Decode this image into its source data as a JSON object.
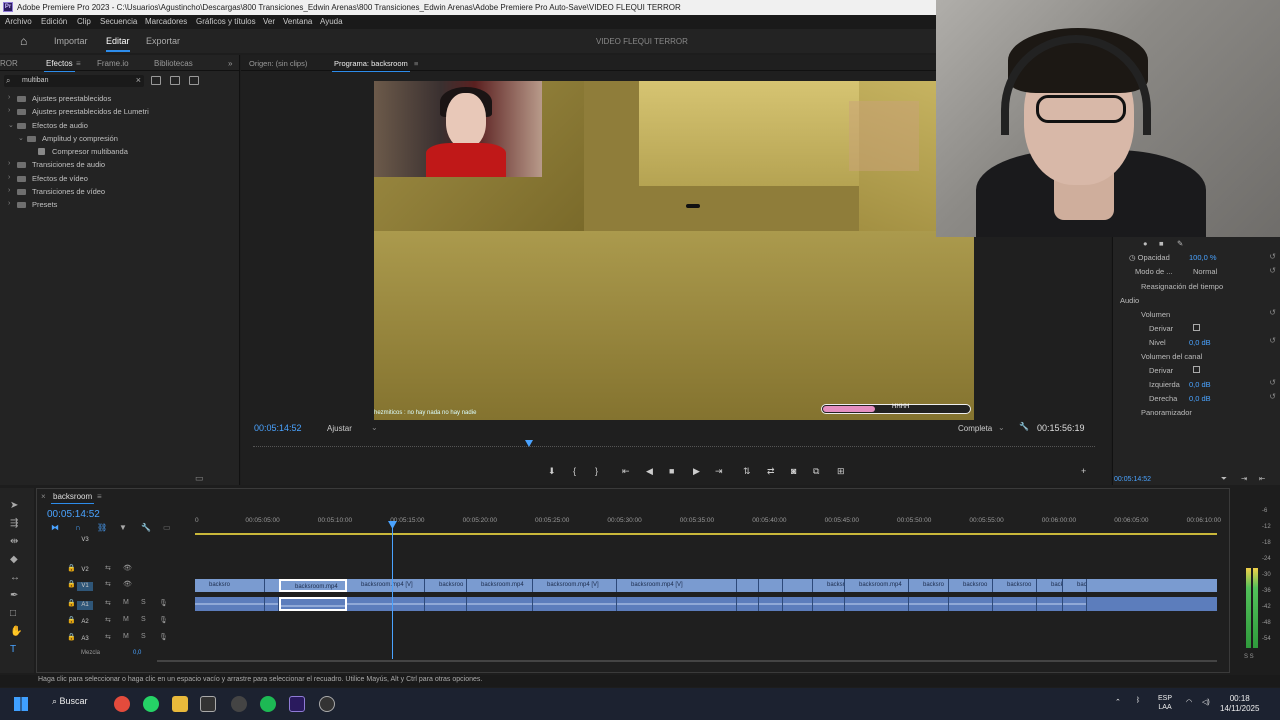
{
  "titlebar": {
    "text": "Adobe Premiere Pro 2023 - C:\\Usuarios\\Agustincho\\Descargas\\800 Transiciones_Edwin Arenas\\800 Transiciones_Edwin Arenas\\Adobe Premiere Pro Auto-Save\\VIDEO FLEQUI TERROR"
  },
  "menu": [
    "Archivo",
    "Edición",
    "Clip",
    "Secuencia",
    "Marcadores",
    "Gráficos y títulos",
    "Ver",
    "Ventana",
    "Ayuda"
  ],
  "workspace": {
    "tabs": [
      "Importar",
      "Editar",
      "Exportar"
    ],
    "active": "Editar",
    "project_title": "VIDEO FLEQUI TERROR"
  },
  "effects_panel": {
    "tab_cut": "ROR",
    "tabs": [
      "Efectos",
      "Frame.io",
      "Bibliotecas"
    ],
    "search_value": "multiban",
    "tree": [
      {
        "label": "Ajustes preestablecidos",
        "indent": 0,
        "kind": "folder",
        "open": false
      },
      {
        "label": "Ajustes preestablecidos de Lumetri",
        "indent": 0,
        "kind": "folder",
        "open": false
      },
      {
        "label": "Efectos de audio",
        "indent": 0,
        "kind": "folder",
        "open": true
      },
      {
        "label": "Amplitud y compresión",
        "indent": 1,
        "kind": "folder",
        "open": true
      },
      {
        "label": "Compresor multibanda",
        "indent": 2,
        "kind": "effect",
        "open": false
      },
      {
        "label": "Transiciones de audio",
        "indent": 0,
        "kind": "folder",
        "open": false
      },
      {
        "label": "Efectos de vídeo",
        "indent": 0,
        "kind": "folder",
        "open": false
      },
      {
        "label": "Transiciones de vídeo",
        "indent": 0,
        "kind": "folder",
        "open": false
      },
      {
        "label": "Presets",
        "indent": 0,
        "kind": "folder",
        "open": false
      }
    ]
  },
  "program_monitor": {
    "source_tab": "Origen: (sin clips)",
    "program_tab": "Programa: backsroom",
    "timecode": "00:05:14:52",
    "fit": "Ajustar",
    "quality": "Completa",
    "duration": "00:15:56:19",
    "chat_line": "hezmiticos : no hay nada no hay nadie",
    "hp_text": "HHHH",
    "hp_fill": 0.35
  },
  "effect_controls": {
    "opacity_label": "Opacidad",
    "opacity_value": "100,0 %",
    "blend_label": "Modo de ...",
    "blend_value": "Normal",
    "time_remap": "Reasignación del tiempo",
    "audio_label": "Audio",
    "volume": "Volumen",
    "bypass": "Derivar",
    "level": "Nivel",
    "level_value": "0,0 dB",
    "channel_volume": "Volumen del canal",
    "bypass2": "Derivar",
    "left": "Izquierda",
    "left_value": "0,0 dB",
    "right": "Derecha",
    "right_value": "0,0 dB",
    "panner": "Panoramizador",
    "footer_tc": "00:05:14:52"
  },
  "timeline": {
    "sequence": "backsroom",
    "timecode": "00:05:14:52",
    "ruler": [
      "0",
      "00:05:05:00",
      "00:05:10:00",
      "00:05:15:00",
      "00:05:20:00",
      "00:05:25:00",
      "00:05:30:00",
      "00:05:35:00",
      "00:05:40:00",
      "00:05:45:00",
      "00:05:50:00",
      "00:05:55:00",
      "00:06:00:00",
      "00:06:05:00",
      "00:06:10:00"
    ],
    "tracks": {
      "v3": "V3",
      "v2": "V2",
      "v1": "V1",
      "a1": "A1",
      "a2": "A2",
      "a3": "A3",
      "mix": "Mezcla",
      "mix_value": "0,0",
      "mute": "M",
      "solo": "S"
    },
    "v1_clips": [
      {
        "label": "backsro"
      },
      {
        "label": ""
      },
      {
        "label": "backsroom.mp4"
      },
      {
        "label": "backsroom.mp4 [V]"
      },
      {
        "label": "backsroo"
      },
      {
        "label": "backsroom.mp4"
      },
      {
        "label": "backsroom.mp4 [V]"
      },
      {
        "label": "backsroom.mp4 [V]"
      },
      {
        "label": ""
      },
      {
        "label": ""
      },
      {
        "label": ""
      },
      {
        "label": "backsro"
      },
      {
        "label": "backsroom.mp4"
      },
      {
        "label": "backsro"
      },
      {
        "label": "backsroo"
      },
      {
        "label": "backsroo"
      },
      {
        "label": "back"
      },
      {
        "label": "backsro"
      }
    ]
  },
  "meters": {
    "labels": [
      "-6",
      "-12",
      "-18",
      "-24",
      "-30",
      "-36",
      "-42",
      "-48",
      "-54"
    ],
    "footer": "S S"
  },
  "status": "Haga clic para seleccionar o haga clic en un espacio vacío y arrastre para seleccionar el recuadro. Utilice Mayús, Alt y Ctrl para otras opciones.",
  "taskbar": {
    "search": "Buscar",
    "lang": "ESP",
    "region": "LAA",
    "time": "00:18",
    "date": "14/11/2025"
  },
  "colors": {
    "accent": "#2d8ceb",
    "timecode": "#4aa3ff",
    "clip_video": "#7a9bd0",
    "clip_audio": "#5c7dbc"
  }
}
